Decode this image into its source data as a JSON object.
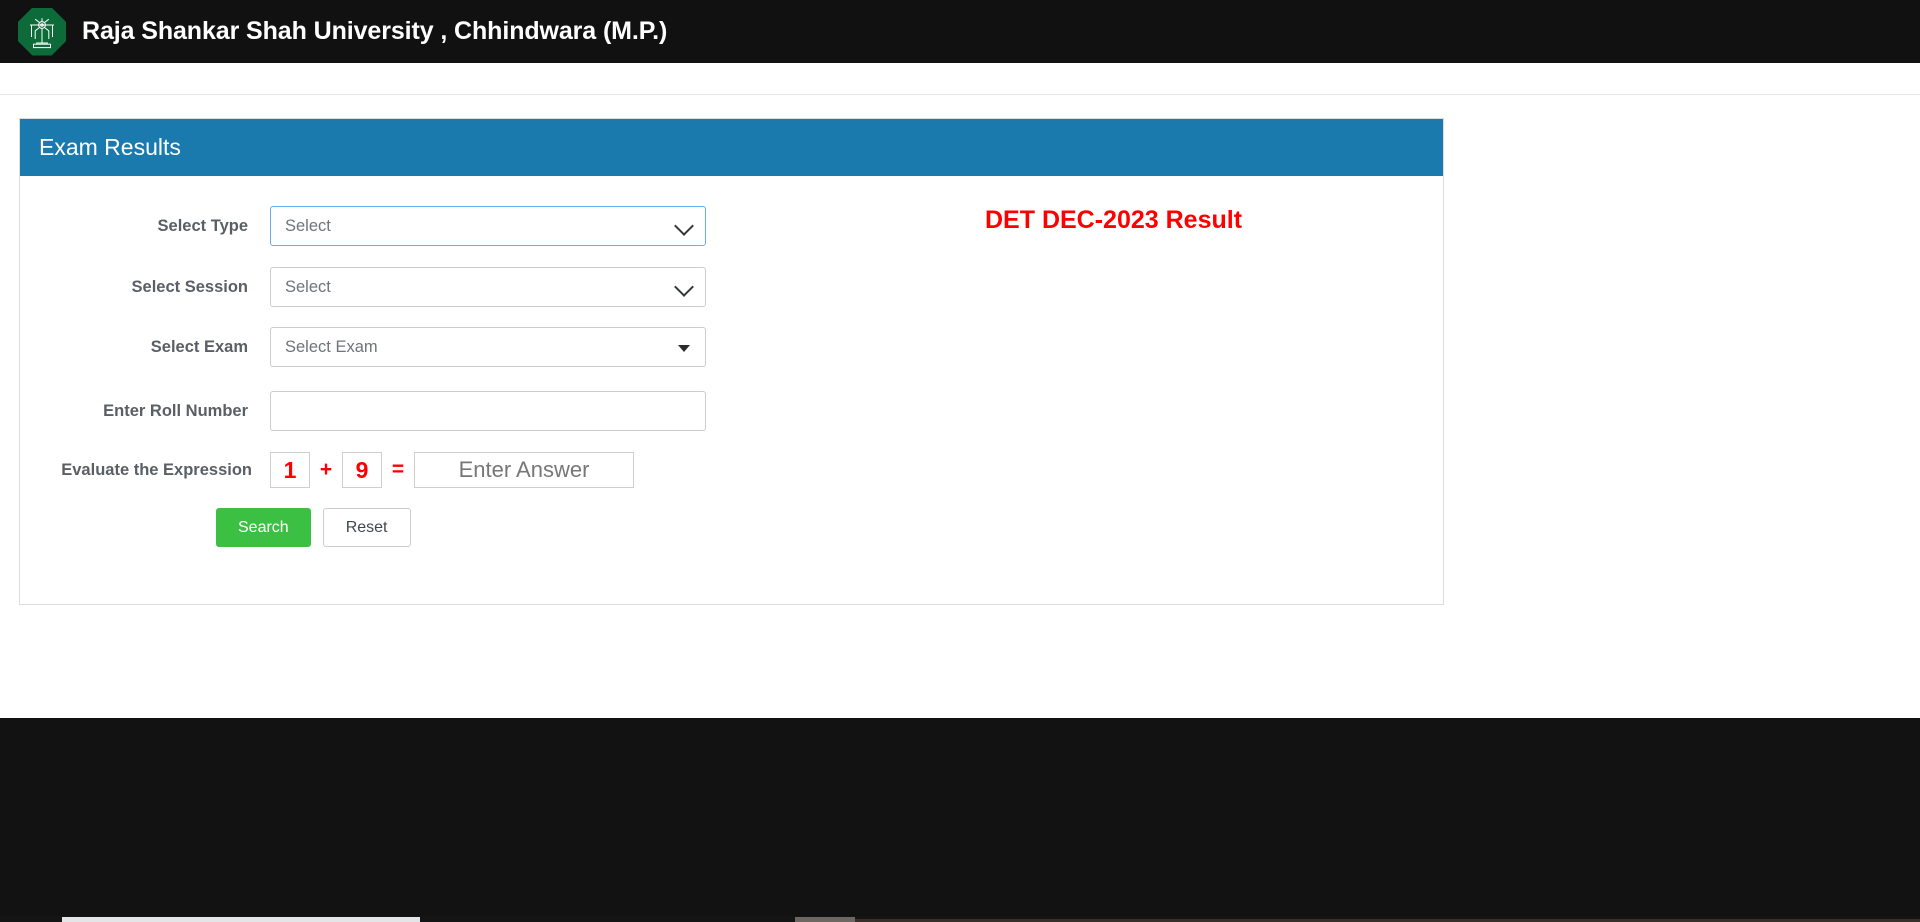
{
  "navbar": {
    "logo_icon": "university-tree-emblem-icon",
    "logo_color": "#0c6b38",
    "title": "Raja Shankar Shah University , Chhindwara (M.P.)"
  },
  "panel": {
    "heading": "Exam Results",
    "heading_color": "#1a7aad"
  },
  "form": {
    "rows": [
      {
        "label": "Select Type",
        "value": "Select",
        "control": "select",
        "focused": true
      },
      {
        "label": "Select Session",
        "value": "Select",
        "control": "select",
        "focused": false
      },
      {
        "label": "Select Exam",
        "value": "Select Exam",
        "control": "dropdown",
        "focused": false
      },
      {
        "label": "Enter Roll Number",
        "value": "",
        "control": "text",
        "placeholder": ""
      }
    ],
    "captcha": {
      "label": "Evaluate the Expression",
      "operand_left": "1",
      "operator": "+",
      "operand_right": "9",
      "equals": "=",
      "answer_value": "",
      "answer_placeholder": "Enter Answer",
      "digit_color": "#ff0000"
    },
    "buttons": {
      "search_label": "Search",
      "search_color": "#3cc043",
      "reset_label": "Reset"
    }
  },
  "result": {
    "heading": "DET DEC-2023 Result",
    "heading_color": "#ff0000"
  }
}
